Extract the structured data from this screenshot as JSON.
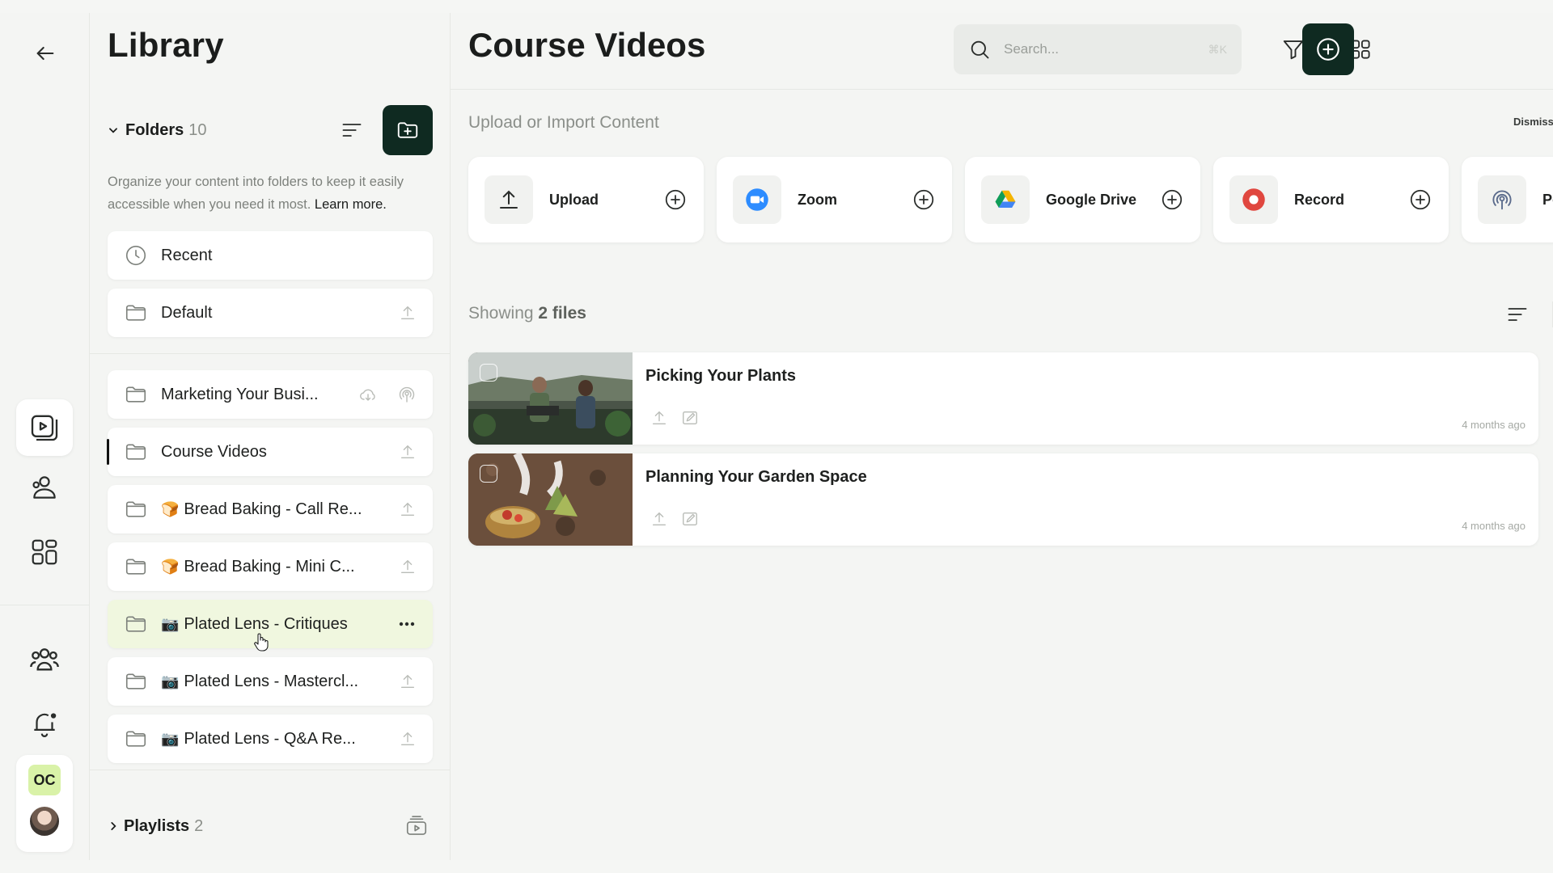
{
  "library": {
    "title": "Library",
    "folders_label": "Folders",
    "folders_count": "10",
    "description": "Organize your content into folders to keep it easily accessible when you need it most.",
    "learn_more": "Learn more.",
    "pinned": [
      {
        "label": "Recent",
        "icon": "clock-icon"
      },
      {
        "label": "Default",
        "icon": "folder-icon"
      }
    ],
    "folders": [
      {
        "label": "Marketing Your Busi...",
        "emoji": ""
      },
      {
        "label": "Course Videos",
        "emoji": ""
      },
      {
        "label": "Bread Baking - Call Re...",
        "emoji": "🍞"
      },
      {
        "label": "Bread Baking - Mini C...",
        "emoji": "🍞"
      },
      {
        "label": "Plated Lens - Critiques",
        "emoji": "📷"
      },
      {
        "label": "Plated Lens - Mastercl...",
        "emoji": "📷"
      },
      {
        "label": "Plated Lens - Q&A Re...",
        "emoji": "📷"
      }
    ],
    "playlists_label": "Playlists",
    "playlists_count": "2"
  },
  "rail": {
    "profile_initials": "OC"
  },
  "main": {
    "title": "Course Videos",
    "search_placeholder": "Search...",
    "search_shortcut": "⌘K",
    "upload_title": "Upload or Import Content",
    "dismiss_label": "Dismiss",
    "sources": [
      {
        "label": "Upload",
        "icon": "upload-icon"
      },
      {
        "label": "Zoom",
        "icon": "zoom-icon"
      },
      {
        "label": "Google Drive",
        "icon": "google-drive-icon"
      },
      {
        "label": "Record",
        "icon": "record-icon"
      },
      {
        "label": "Podcast",
        "icon": "podcast-icon"
      }
    ],
    "showing_prefix": "Showing",
    "showing_count": "2 files",
    "files": [
      {
        "title": "Picking Your Plants",
        "time": "4 months ago"
      },
      {
        "title": "Planning Your Garden Space",
        "time": "4 months ago"
      }
    ]
  },
  "colors": {
    "accent_dark": "#0f2a21",
    "hover_row": "#f0f7df",
    "badge_bg": "#d9f2a8",
    "record_red": "#e0473f",
    "zoom_blue": "#2d8cff"
  }
}
